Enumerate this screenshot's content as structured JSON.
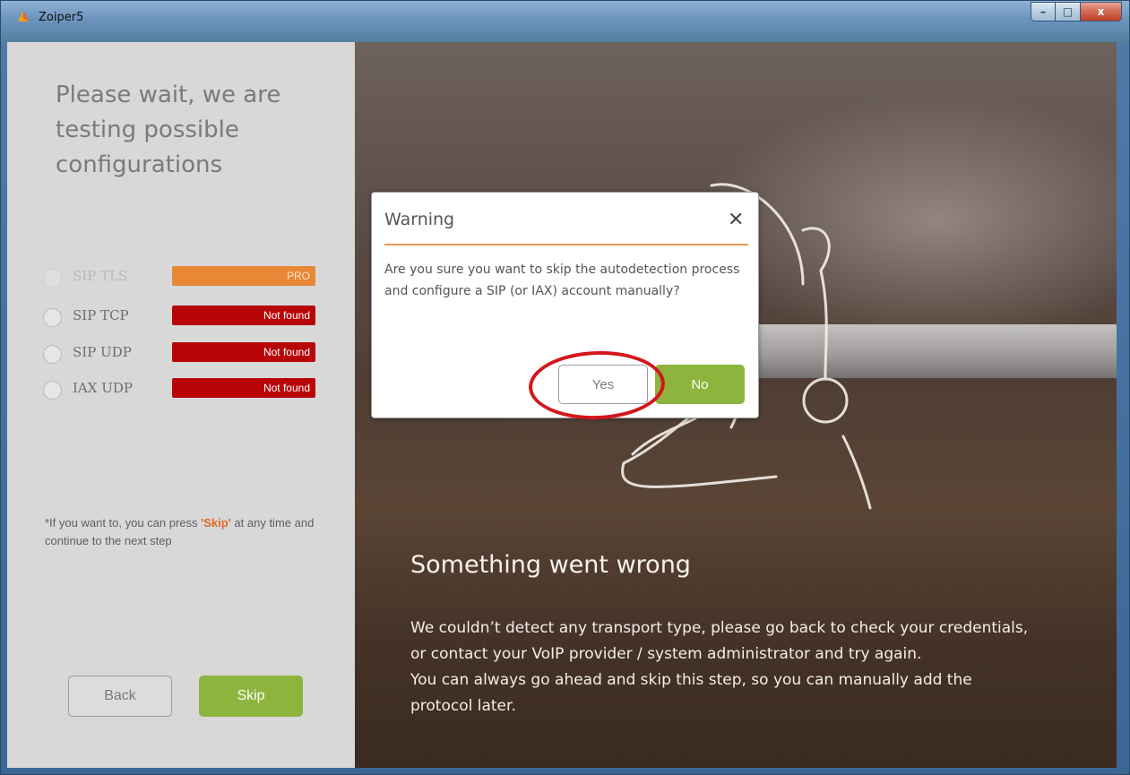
{
  "window": {
    "title": "Zoiper5",
    "controls": {
      "minimize": "–",
      "maximize": "□",
      "close": "x"
    }
  },
  "left": {
    "heading": "Please wait, we are testing possible configurations",
    "protocols": [
      {
        "label": "SIP TLS",
        "status": "PRO",
        "state": "pro"
      },
      {
        "label": "SIP TCP",
        "status": "Not found",
        "state": "not-found"
      },
      {
        "label": "SIP UDP",
        "status": "Not found",
        "state": "not-found"
      },
      {
        "label": "IAX UDP",
        "status": "Not found",
        "state": "not-found"
      }
    ],
    "note_prefix": "*If you want to, you can press ",
    "note_quote_open": "'",
    "note_skip": "Skip",
    "note_quote_close": "'",
    "note_suffix": " at any time and continue to the next step",
    "back_label": "Back",
    "skip_label": "Skip"
  },
  "right": {
    "title": "Something went wrong",
    "body_line1": "We couldn’t detect any transport type, please go back to check your credentials, or contact your VoIP provider / system administrator and try again.",
    "body_line2": "You can always go ahead and skip this step, so you can manually add the protocol later."
  },
  "dialog": {
    "title": "Warning",
    "close_glyph": "✕",
    "message": "Are you sure you want to skip the autodetection process and configure a SIP (or IAX) account manually?",
    "yes_label": "Yes",
    "no_label": "No"
  },
  "colors": {
    "accent_green": "#8db43c",
    "pro_orange": "#e88735",
    "not_found_red": "#b80606",
    "dialog_rule": "#e49b53",
    "annotation_red": "#d4151b"
  }
}
